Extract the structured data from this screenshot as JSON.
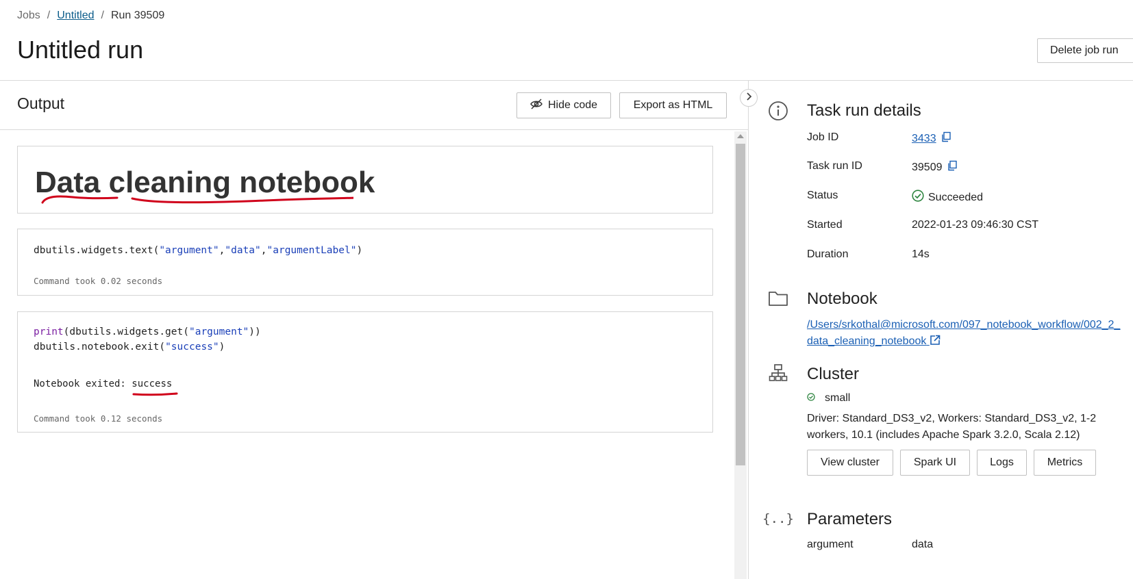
{
  "breadcrumb": {
    "jobs": "Jobs",
    "sep1": "/",
    "job": "Untitled",
    "sep2": "/",
    "run": "Run 39509"
  },
  "page": {
    "title": "Untitled run",
    "delete_label": "Delete job run"
  },
  "output": {
    "title": "Output",
    "hide_code_label": "Hide code",
    "export_label": "Export as HTML",
    "md_heading": "Data cleaning notebook",
    "cell1": {
      "fn": "dbutils.widgets.text(",
      "arg1": "\"argument\"",
      "comma1": ",",
      "arg2": "\"data\"",
      "comma2": ",",
      "arg3": "\"argumentLabel\"",
      "close": ")",
      "took": "Command took 0.02 seconds"
    },
    "cell2": {
      "kw_print": "print",
      "line1_rest": "(dbutils.widgets.get(",
      "line1_arg": "\"argument\"",
      "line1_close": "))",
      "line2_fn": "dbutils.notebook.exit(",
      "line2_arg": "\"success\"",
      "line2_close": ")",
      "exit_prefix": "Notebook exited: ",
      "exit_value": "success",
      "took": "Command took 0.12 seconds"
    }
  },
  "details": {
    "title": "Task run details",
    "job_id_label": "Job ID",
    "job_id": "3433",
    "task_run_id_label": "Task run ID",
    "task_run_id": "39509",
    "status_label": "Status",
    "status": "Succeeded",
    "started_label": "Started",
    "started": "2022-01-23 09:46:30 CST",
    "duration_label": "Duration",
    "duration": "14s"
  },
  "notebook": {
    "title": "Notebook",
    "path": "/Users/srkothal@microsoft.com/097_notebook_workflow/002_2_data_cleaning_notebook"
  },
  "cluster": {
    "title": "Cluster",
    "name": "small",
    "description": "Driver: Standard_DS3_v2, Workers: Standard_DS3_v2, 1-2 workers, 10.1 (includes Apache Spark 3.2.0, Scala 2.12)",
    "view_cluster": "View cluster",
    "spark_ui": "Spark UI",
    "logs": "Logs",
    "metrics": "Metrics"
  },
  "parameters": {
    "title": "Parameters",
    "name": "argument",
    "value": "data"
  },
  "colors": {
    "link": "#1a5fb4",
    "success": "#2e8540",
    "annotation": "#d0021b"
  },
  "icons": [
    "info-icon",
    "folder-icon",
    "cluster-icon",
    "braces-icon",
    "copy-icon",
    "external-link-icon",
    "check-circle-icon",
    "eye-off-icon",
    "chevron-right-icon"
  ]
}
